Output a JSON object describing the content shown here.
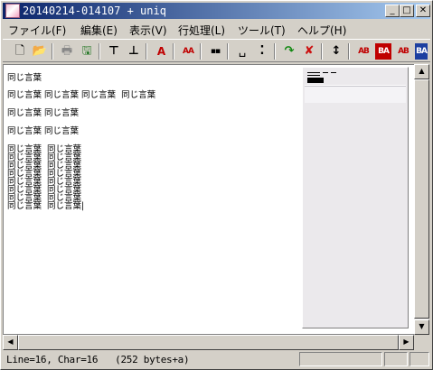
{
  "window": {
    "title": "20140214-014107 + uniq",
    "minimize_glyph": "_",
    "maximize_glyph": "□",
    "close_glyph": "✕"
  },
  "menu": [
    {
      "label": "ファイル(F)"
    },
    {
      "label": "編集(E)"
    },
    {
      "label": "表示(V)"
    },
    {
      "label": "行処理(L)"
    },
    {
      "label": "ツール(T)"
    },
    {
      "label": "ヘルプ(H)"
    }
  ],
  "toolbar": [
    {
      "name": "new-file-icon",
      "glyph": "🗋"
    },
    {
      "name": "open-folder-icon",
      "glyph": "📂"
    },
    {
      "name": "print-preview-icon",
      "glyph": "🖶"
    },
    {
      "name": "save-icon",
      "glyph": "🖫"
    },
    {
      "name": "go-top-icon",
      "glyph": "⊤"
    },
    {
      "name": "go-bottom-icon",
      "glyph": "⊥"
    },
    {
      "name": "font-size-icon",
      "glyph": "A"
    },
    {
      "name": "case-icon",
      "glyph": "AA"
    },
    {
      "name": "grid-icon",
      "glyph": "▪▪"
    },
    {
      "name": "space-icon",
      "glyph": "␣"
    },
    {
      "name": "colon-icon",
      "glyph": "⁚"
    },
    {
      "name": "green-arrow-icon",
      "glyph": "↷"
    },
    {
      "name": "red-cross-icon",
      "glyph": "✘"
    },
    {
      "name": "updown-icon",
      "glyph": "↕"
    },
    {
      "name": "sort-ab-icon",
      "glyph": "AB"
    },
    {
      "name": "sort-ba-icon",
      "glyph": "BA"
    },
    {
      "name": "sort-ab-2-icon",
      "glyph": "AB"
    },
    {
      "name": "sort-ba-2-icon",
      "glyph": "BA"
    }
  ],
  "editor": {
    "lines": [
      "同じ言葉",
      "同じ言葉 同じ言葉 同じ言葉  同じ言葉",
      "同じ言葉 同じ言葉",
      "同じ言葉 同じ言葉",
      "同じ言葉  同じ言葉",
      "同じ言葉  同じ言葉",
      "同じ言葉  同じ言葉",
      "同じ言葉  同じ言葉",
      "同じ言葉  同じ言葉",
      "同じ言葉  同じ言葉",
      "同じ言葉  同じ言葉",
      "同じ言葉  同じ言葉|"
    ]
  },
  "scroll": {
    "up_glyph": "▲",
    "down_glyph": "▼",
    "left_glyph": "◀",
    "right_glyph": "▶"
  },
  "status": {
    "text": "Line=16, Char=16   (252 bytes+a)"
  }
}
